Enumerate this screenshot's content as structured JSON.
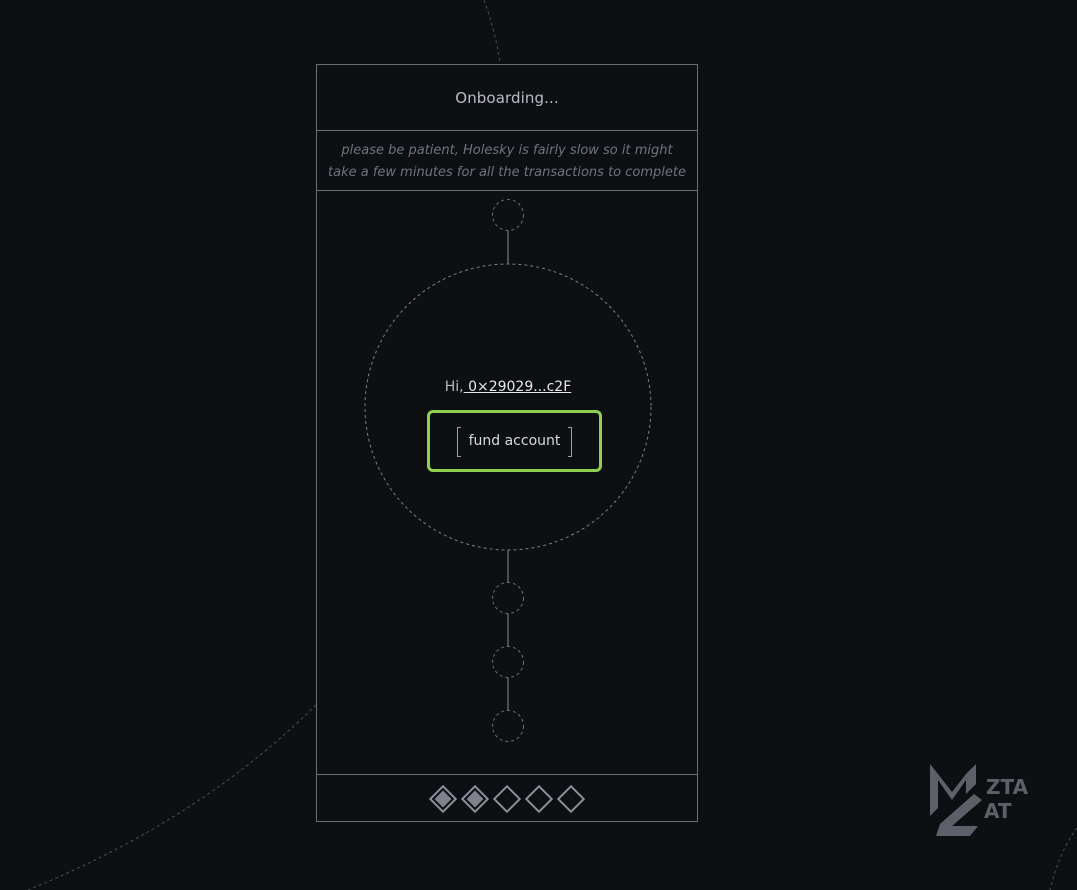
{
  "panel": {
    "title": "Onboarding...",
    "note": "please be patient, Holesky is fairly slow so it might take a few minutes for all the transactions to complete"
  },
  "account": {
    "greeting_prefix": "Hi,",
    "address_short": "0×29029...c2F",
    "fund_label": "fund account"
  },
  "progress": {
    "total_steps": 5,
    "completed_steps": 2
  },
  "watermark": {
    "line1": "ZTA",
    "line2": "AT"
  },
  "colors": {
    "background": "#0e0f13",
    "border": "#6b6e75",
    "highlight": "#8fd14f"
  }
}
